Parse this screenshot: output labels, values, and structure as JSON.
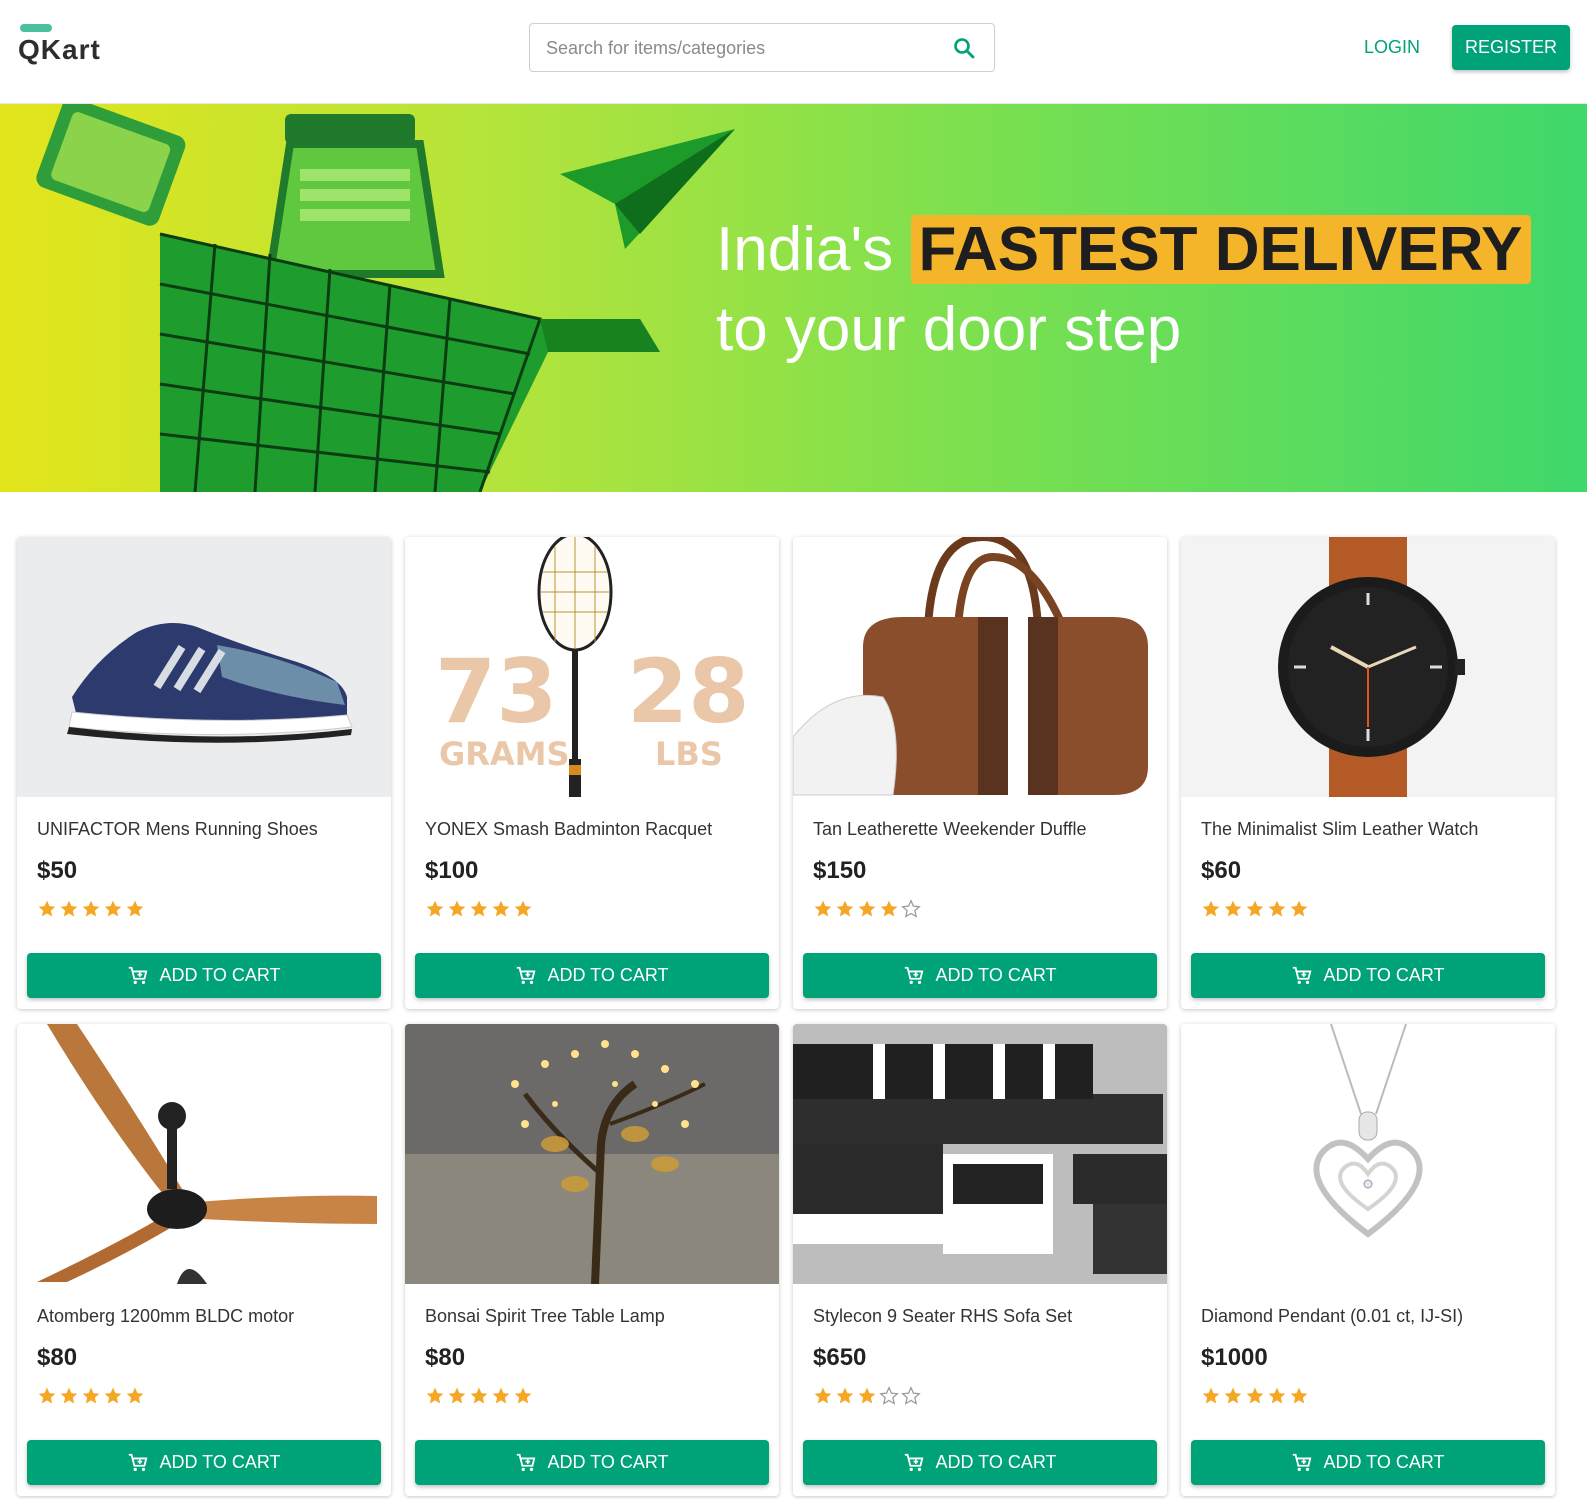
{
  "header": {
    "logo": "QKart",
    "search": {
      "placeholder": "Search for items/categories"
    },
    "login_label": "LOGIN",
    "register_label": "REGISTER"
  },
  "hero": {
    "line1_prefix": "India's",
    "line1_highlight": "FASTEST DELIVERY",
    "line2": "to your door step"
  },
  "colors": {
    "accent": "#00a278",
    "star": "#f5a623",
    "highlight": "#f5b52a"
  },
  "products": [
    {
      "name": "UNIFACTOR Mens Running Shoes",
      "price": "$50",
      "rating": 5,
      "button": "ADD TO CART",
      "image": "shoe"
    },
    {
      "name": "YONEX Smash Badminton Racquet",
      "price": "$100",
      "rating": 5,
      "button": "ADD TO CART",
      "image": "racquet",
      "image_text": [
        "73",
        "28",
        "GRAMS",
        "LBS"
      ]
    },
    {
      "name": "Tan Leatherette Weekender Duffle",
      "price": "$150",
      "rating": 4,
      "button": "ADD TO CART",
      "image": "duffle"
    },
    {
      "name": "The Minimalist Slim Leather Watch",
      "price": "$60",
      "rating": 5,
      "button": "ADD TO CART",
      "image": "watch"
    },
    {
      "name": "Atomberg 1200mm BLDC motor",
      "price": "$80",
      "rating": 5,
      "button": "ADD TO CART",
      "image": "fan"
    },
    {
      "name": "Bonsai Spirit Tree Table Lamp",
      "price": "$80",
      "rating": 5,
      "button": "ADD TO CART",
      "image": "lamp"
    },
    {
      "name": "Stylecon 9 Seater RHS Sofa Set",
      "price": "$650",
      "rating": 3,
      "button": "ADD TO CART",
      "image": "sofa"
    },
    {
      "name": "Diamond Pendant (0.01 ct, IJ-SI)",
      "price": "$1000",
      "rating": 5,
      "button": "ADD TO CART",
      "image": "pendant"
    }
  ]
}
